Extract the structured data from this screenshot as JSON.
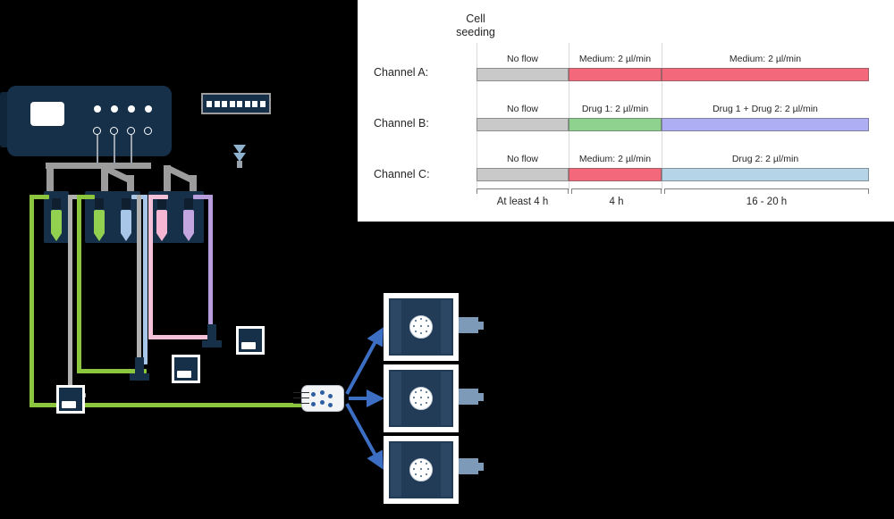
{
  "figure": {
    "background_color": "#000000",
    "panel_color": "#ffffff"
  },
  "timeline": {
    "cell_seeding_line1": "Cell",
    "cell_seeding_line2": "seeding",
    "channels": [
      {
        "label": "Channel A:",
        "segments": [
          {
            "text": "No flow",
            "color": "#c9c9c9"
          },
          {
            "text": "Medium: 2 µl/min",
            "color": "#f4687b"
          },
          {
            "text": "Medium: 2 µl/min",
            "color": "#f4687b"
          }
        ]
      },
      {
        "label": "Channel B:",
        "segments": [
          {
            "text": "No flow",
            "color": "#c9c9c9"
          },
          {
            "text": "Drug 1: 2 µl/min",
            "color": "#8fd18f"
          },
          {
            "text": "Drug 1 + Drug 2:  2 µl/min",
            "color": "#aeaef4"
          }
        ]
      },
      {
        "label": "Channel C:",
        "segments": [
          {
            "text": "No flow",
            "color": "#c9c9c9"
          },
          {
            "text": "Medium: 2 µl/min",
            "color": "#f4687b"
          },
          {
            "text": "Drug 2:  2 µl/min",
            "color": "#b6d4e8"
          }
        ]
      }
    ],
    "durations": [
      {
        "text": "At least 4 h"
      },
      {
        "text": "4 h"
      },
      {
        "text": "16 - 20 h"
      }
    ]
  },
  "apparatus": {
    "pump": {
      "name": "pressure-pump-controller",
      "body_color": "#17304a",
      "dot_count": 4,
      "port_count": 4
    },
    "barcode_module": {
      "cell_count": 8,
      "body_color": "#17304a"
    },
    "reservoirs": [
      {
        "rack": 1,
        "tubes": [
          {
            "liquid_color": "#92d050"
          }
        ]
      },
      {
        "rack": 2,
        "tubes": [
          {
            "liquid_color": "#92d050"
          },
          {
            "liquid_color": "#a8c6e8"
          }
        ]
      },
      {
        "rack": 3,
        "tubes": [
          {
            "liquid_color": "#f4b6d2"
          },
          {
            "liquid_color": "#c3a5e0"
          }
        ]
      }
    ],
    "tubing_colors": {
      "green": "#8cc63f",
      "gray": "#b0b0b0",
      "blue": "#a8c6e8",
      "pink": "#f4c2d8",
      "purple": "#b79ddb"
    },
    "sensor_count": 3,
    "chips": [
      {
        "index": 1,
        "membrane": "cell-culture-membrane"
      },
      {
        "index": 2,
        "membrane": "cell-culture-membrane"
      },
      {
        "index": 3,
        "membrane": "cell-culture-membrane"
      }
    ],
    "arrow_color": "#3c6fc4",
    "manifold": {
      "dot_count": 6,
      "inlet_line_count": 3
    }
  }
}
